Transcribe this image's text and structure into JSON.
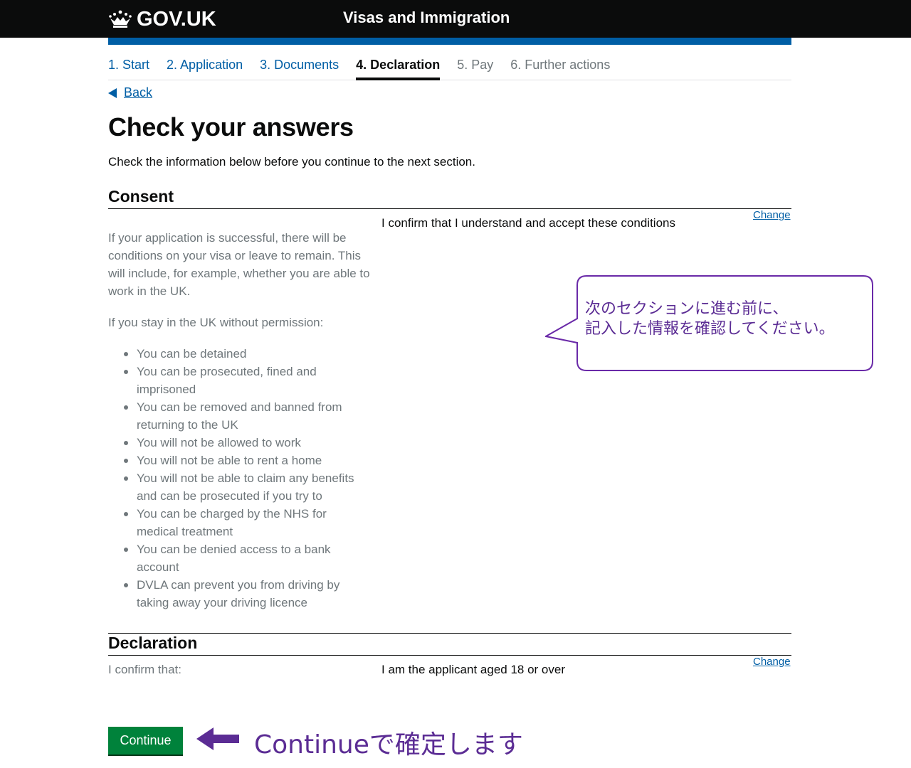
{
  "header": {
    "logo_text": "GOV.UK",
    "logo_icon": "crown-icon",
    "service_name": "Visas and Immigration"
  },
  "steps": [
    {
      "label": "1. Start",
      "state": "link"
    },
    {
      "label": "2. Application",
      "state": "link"
    },
    {
      "label": "3. Documents",
      "state": "link"
    },
    {
      "label": "4. Declaration",
      "state": "active"
    },
    {
      "label": "5. Pay",
      "state": "disabled"
    },
    {
      "label": "6. Further actions",
      "state": "disabled"
    }
  ],
  "back_link": "Back",
  "page_title": "Check your answers",
  "intro": "Check the information below before you continue to the next section.",
  "consent": {
    "title": "Consent",
    "answer": "I confirm that I understand and accept these conditions",
    "change_label": "Change",
    "paragraph1": "If your application is successful, there will be conditions on your visa or leave to remain. This will include, for example, whether you are able to work in the UK.",
    "paragraph2": "If you stay in the UK without permission:",
    "bullets": [
      "You can be detained",
      "You can be prosecuted, fined and imprisoned",
      "You can be removed and banned from returning to the UK",
      "You will not be allowed to work",
      "You will not be able to rent a home",
      "You will not be able to claim any benefits and can be prosecuted if you try to",
      "You can be charged by the NHS for medical treatment",
      "You can be denied access to a bank account",
      "DVLA can prevent you from driving by taking away your driving licence"
    ]
  },
  "declaration": {
    "title": "Declaration",
    "label": "I confirm that:",
    "answer": "I am the applicant aged 18 or over",
    "change_label": "Change"
  },
  "continue_label": "Continue",
  "annotations": {
    "callout_line1": "次のセクションに進む前に、",
    "callout_line2": "記入した情報を確認してください。",
    "arrow_note": "Continueで確定します",
    "color": "#5b2c94"
  },
  "colors": {
    "header_bg": "#0b0c0c",
    "brand_blue": "#005ea5",
    "button_green": "#00823b",
    "secondary_text": "#6f777b"
  }
}
